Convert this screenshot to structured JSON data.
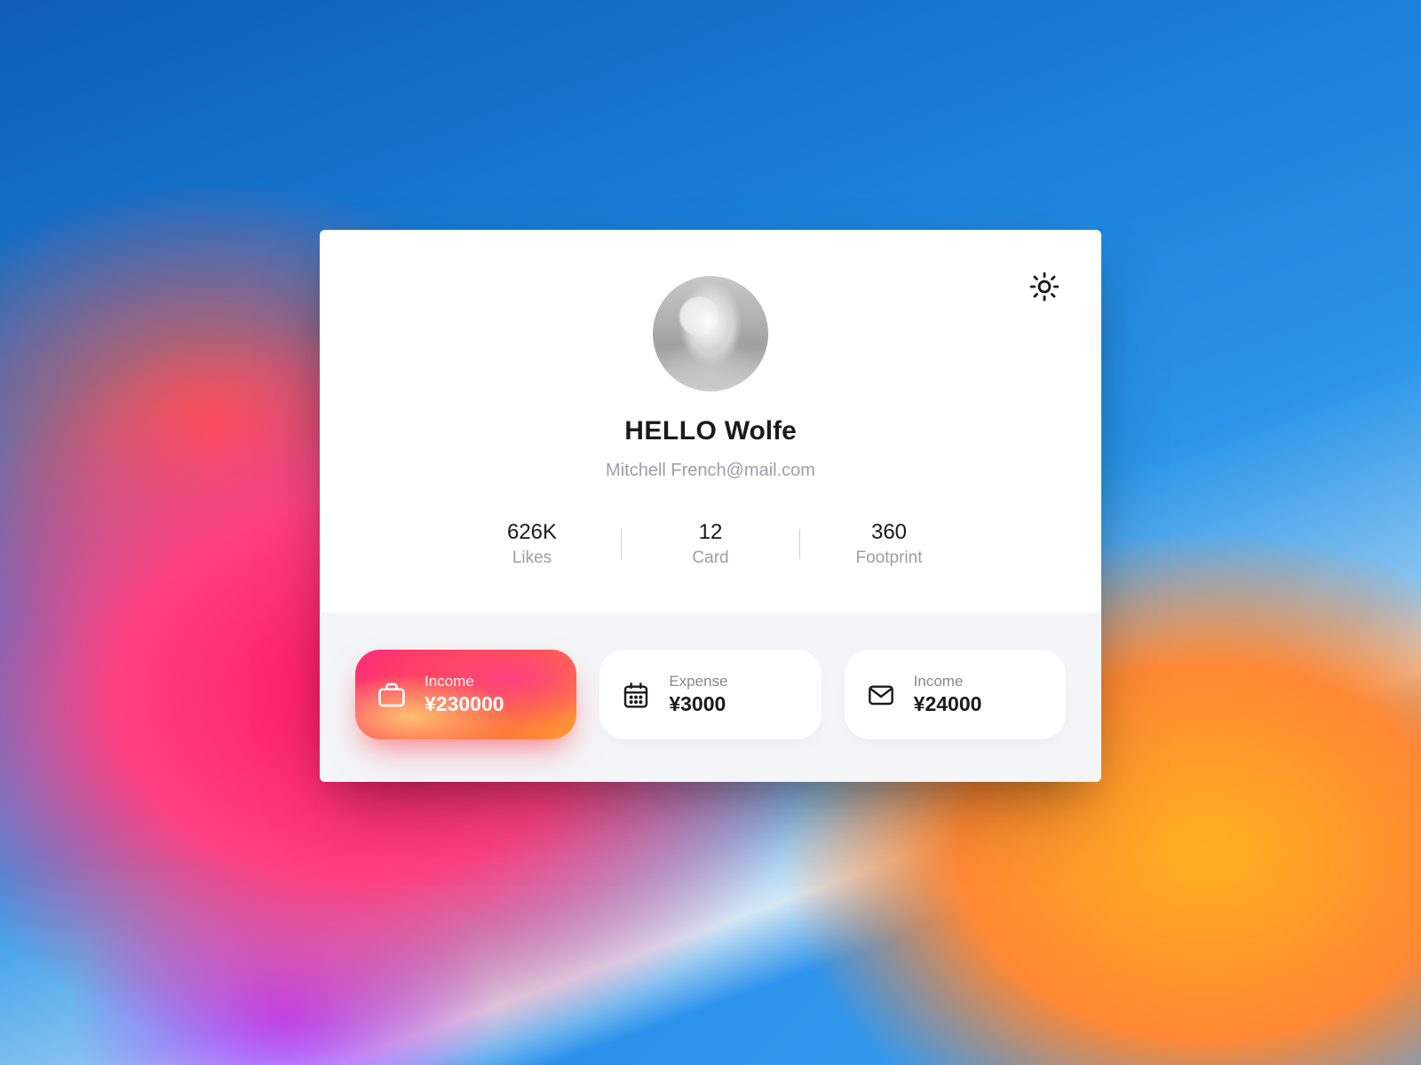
{
  "profile": {
    "greeting_prefix": "HELLO",
    "name": "Wolfe",
    "email": "Mitchell French@mail.com"
  },
  "stats": [
    {
      "value": "626K",
      "label": "Likes"
    },
    {
      "value": "12",
      "label": "Card"
    },
    {
      "value": "360",
      "label": "Footprint"
    }
  ],
  "finance": [
    {
      "label": "Income",
      "value": "¥230000",
      "icon": "briefcase",
      "active": true
    },
    {
      "label": "Expense",
      "value": "¥3000",
      "icon": "calendar",
      "active": false
    },
    {
      "label": "Income",
      "value": "¥24000",
      "icon": "mail",
      "active": false
    }
  ]
}
